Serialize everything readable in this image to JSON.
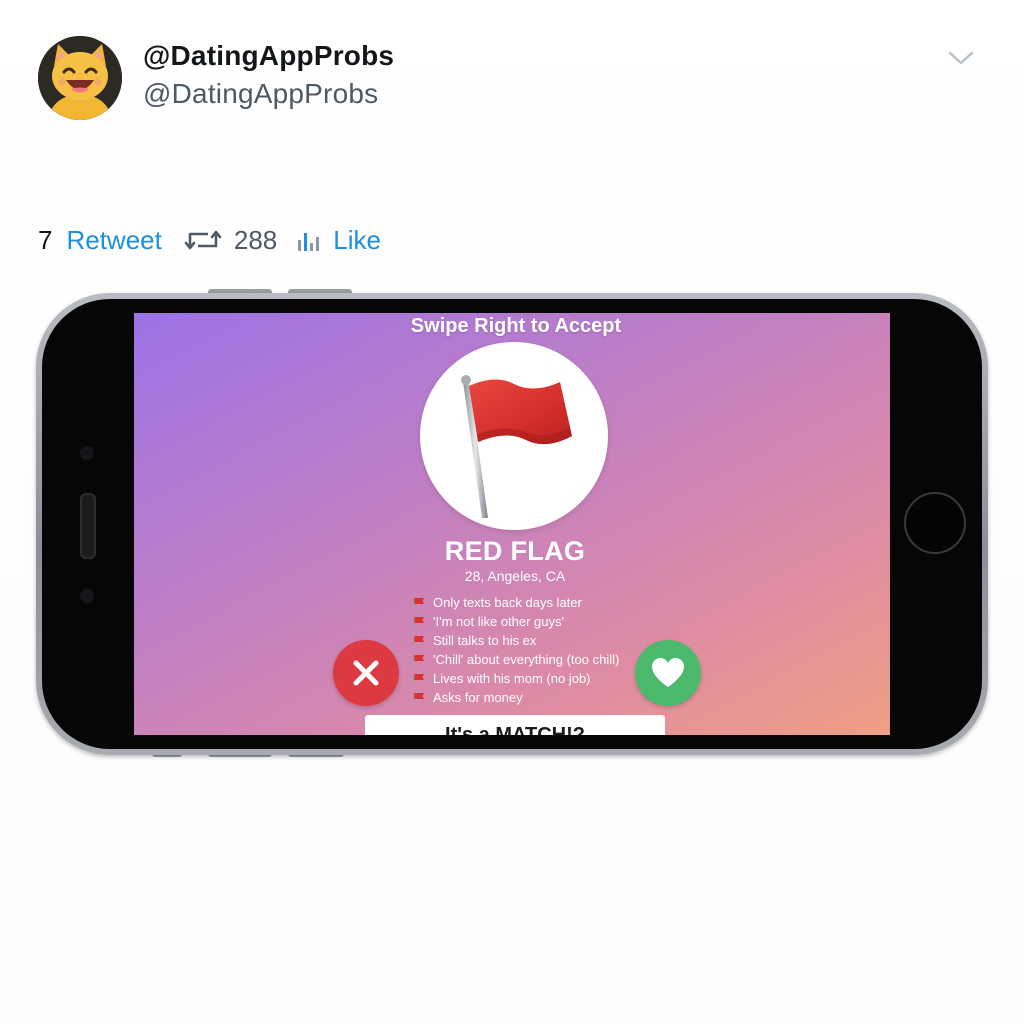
{
  "tweet": {
    "display_name": "@DatingAppProbs",
    "handle": "@DatingAppProbs",
    "avatar_icon": "laughing-cat-icon"
  },
  "actions": {
    "count_left": "7",
    "retweet_label": "Retweet",
    "retweet_count": "288",
    "like_label": "Like",
    "link_color": "#1d8fe0"
  },
  "screen": {
    "title": "Swipe Right to Accept",
    "profile_icon": "red-flag-icon",
    "name": "RED FLAG",
    "location": "28, Angeles, CA",
    "flags": [
      "Only texts back days later",
      "'I'm not like other guys'",
      "Still talks to his ex",
      "'Chill' about everything (too chill)",
      "Lives with his mom (no job)",
      "Asks for money"
    ],
    "reject_icon": "x-icon",
    "like_icon": "heart-icon",
    "match_label": "It's a MATCH!?",
    "colors": {
      "gradient_start": "#9d72e6",
      "gradient_end": "#ef9f83",
      "reject": "#dc3a40",
      "like": "#4cb86c",
      "flag": "#d8312f"
    }
  }
}
